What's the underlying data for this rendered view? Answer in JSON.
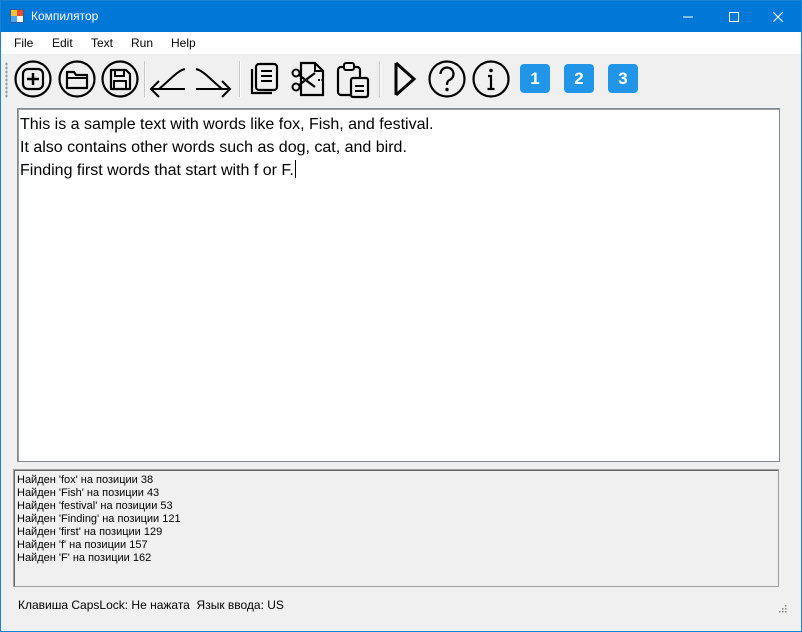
{
  "window": {
    "title": "Компилятор"
  },
  "titlebar": {
    "minimize_icon": "minimize-icon",
    "maximize_icon": "maximize-icon",
    "close_icon": "close-icon"
  },
  "menu": {
    "items": [
      "File",
      "Edit",
      "Text",
      "Run",
      "Help"
    ]
  },
  "toolbar": {
    "buttons": [
      {
        "icon": "new-file-icon"
      },
      {
        "icon": "open-folder-icon"
      },
      {
        "icon": "save-icon"
      },
      {
        "icon": "undo-icon"
      },
      {
        "icon": "redo-icon"
      },
      {
        "icon": "copy-icon"
      },
      {
        "icon": "cut-icon"
      },
      {
        "icon": "paste-icon"
      },
      {
        "icon": "run-icon"
      },
      {
        "icon": "help-icon"
      },
      {
        "icon": "info-icon"
      }
    ],
    "numbered": [
      "1",
      "2",
      "3"
    ],
    "accent": "#2196e8"
  },
  "editor": {
    "lines": [
      "This is a sample text with words like fox, Fish, and festival.",
      "It also contains other words such as dog, cat, and bird.",
      "Finding first words that start with f or F."
    ]
  },
  "output": {
    "lines": [
      "Найден 'fox' на позиции 38",
      "Найден 'Fish' на позиции 43",
      "Найден 'festival' на позиции 53",
      "Найден 'Finding' на позиции 121",
      "Найден 'first' на позиции 129",
      "Найден 'f' на позиции 157",
      "Найден 'F' на позиции 162"
    ]
  },
  "status": {
    "text": "Клавиша CapsLock: Не нажата  Язык ввода: US"
  },
  "colors": {
    "titlebar": "#0078d7",
    "window_bg": "#f0f0f0"
  }
}
